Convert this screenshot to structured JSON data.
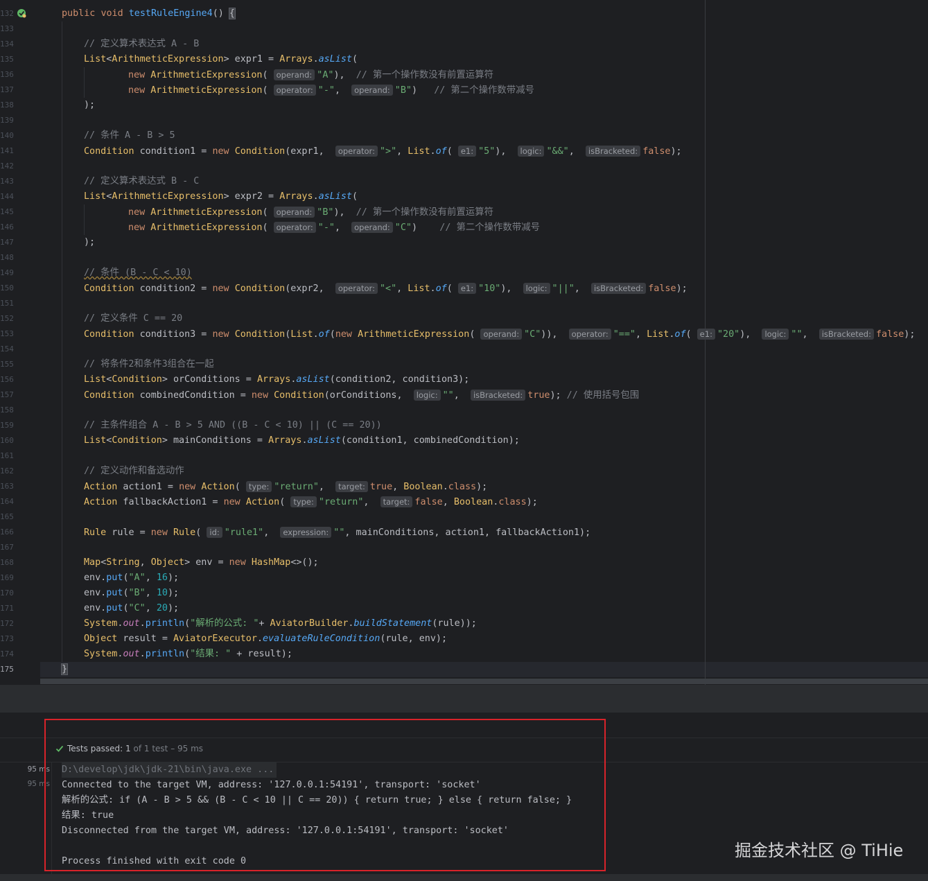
{
  "editor": {
    "line_numbers": [
      "132",
      "133",
      "134",
      "135",
      "136",
      "137",
      "138",
      "139",
      "140",
      "141",
      "142",
      "143",
      "144",
      "145",
      "146",
      "147",
      "148",
      "149",
      "150",
      "151",
      "152",
      "153",
      "154",
      "155",
      "156",
      "157",
      "158",
      "159",
      "160",
      "161",
      "162",
      "163",
      "164",
      "165",
      "166",
      "167",
      "168",
      "169",
      "170",
      "171",
      "172",
      "173",
      "174",
      "175"
    ],
    "current_line": "175",
    "method_signature": {
      "public": "public",
      "void": "void",
      "name": "testRuleEngine4",
      "parens": "()",
      "brace": "{"
    },
    "comments": {
      "c1": "// 定义算术表达式 A - B",
      "c2": "// 第一个操作数没有前置运算符",
      "c3": "// 第二个操作数带减号",
      "c4": "// 条件 A - B > 5",
      "c5": "// 定义算术表达式 B - C",
      "c6": "// 条件 (B - C < 10)",
      "c7": "// 定义条件 C == 20",
      "c8": "// 将条件2和条件3组合在一起",
      "c9": "// 使用括号包围",
      "c10": "// 主条件组合 A - B > 5 AND ((B - C < 10) || (C == 20))",
      "c11": "// 定义动作和备选动作"
    },
    "hints": {
      "operand": "operand:",
      "operator": "operator:",
      "e1": "e1:",
      "logic": "logic:",
      "isBracketed": "isBracketed:",
      "type": "type:",
      "target": "target:",
      "id": "id:",
      "expression": "expression:"
    },
    "closing_brace": "}"
  },
  "run": {
    "status_prefix": "Tests passed:",
    "status_count": "1",
    "status_suffix": "of 1 test – 95 ms",
    "durations": [
      "95 ms",
      "95 ms"
    ],
    "output": [
      "D:\\develop\\jdk\\jdk-21\\bin\\java.exe ...",
      "Connected to the target VM, address: '127.0.0.1:54191', transport: 'socket'",
      "解析的公式: if (A - B > 5 && (B - C < 10 || C == 20)) { return true; } else { return false; }",
      "结果: true",
      "Disconnected from the target VM, address: '127.0.0.1:54191', transport: 'socket'",
      "",
      "Process finished with exit code 0"
    ]
  },
  "watermark": "掘金技术社区 @ TiHie",
  "colors": {
    "background": "#1e1f22",
    "keyword": "#cf8e6d",
    "string": "#6aab73",
    "number": "#2aacb8",
    "method": "#56a8f5",
    "comment": "#7a7e85",
    "highlight_box": "#d8232a",
    "check": "#5fb865"
  }
}
